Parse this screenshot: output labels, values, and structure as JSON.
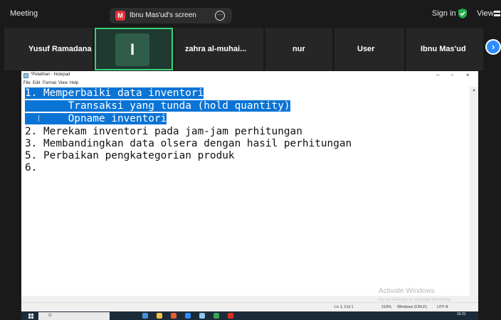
{
  "topbar": {
    "title": "Meeting",
    "share_badge": "M",
    "share_text": "Ibnu Mas'ud's screen",
    "more_glyph": "⋯",
    "signin": "Sign in",
    "view": "View"
  },
  "participants": {
    "tiles": [
      "Yusuf Ramadana",
      "I",
      "zahra al-muhai...",
      "nur",
      "User",
      "Ibnu Mas'ud"
    ],
    "next_glyph": "›"
  },
  "notepad": {
    "title": "*Pelatihan - Notepad",
    "menu": [
      "File",
      "Edit",
      "Format",
      "View",
      "Help"
    ],
    "lines": [
      "1. Memperbaiki data inventori",
      "       Transaksi yang tunda (hold quantity)",
      "       Opname inventori",
      "2. Merekam inventori pada jam-jam perhitungan",
      "3. Membandingkan data olsera dengan hasil perhitungan",
      "5. Perbaikan pengkategorian produk",
      "6."
    ],
    "status": {
      "position": "Ln 1, Col 1",
      "zoom": "210%",
      "eol": "Windows (CRLF)",
      "encoding": "UTF-8"
    },
    "activate_title": "Activate Windows",
    "activate_sub": "Go to Settings to activate Windows."
  },
  "taskbar": {
    "search_placeholder": "O",
    "time": "16:31"
  },
  "colors": {
    "selection": "#0a74d6",
    "active_border": "#3ad178",
    "accent": "#2d8cff"
  }
}
